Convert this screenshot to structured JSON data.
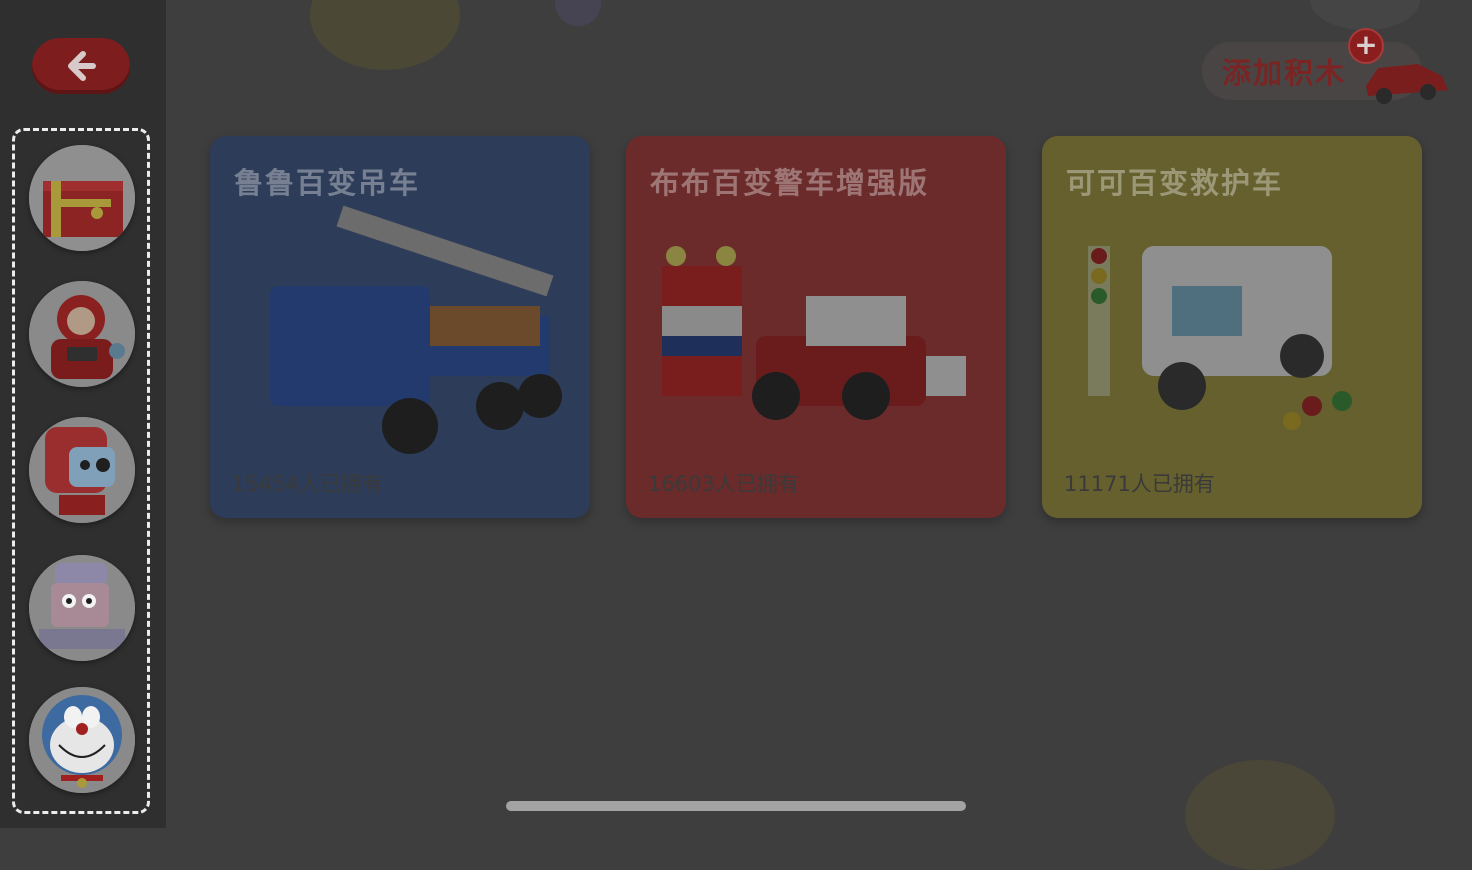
{
  "back_button": {
    "icon": "arrow-left-icon"
  },
  "avatars": [
    {
      "name": "toolbox-avatar"
    },
    {
      "name": "red-robot-avatar"
    },
    {
      "name": "pink-robot-avatar"
    },
    {
      "name": "lilac-robot-avatar"
    },
    {
      "name": "doraemon-avatar"
    }
  ],
  "add_block": {
    "label": "添加积木",
    "icon": "plus-icon"
  },
  "cards": [
    {
      "title": "鲁鲁百变吊车",
      "count": "15454人已拥有",
      "color": "#2a3a55",
      "accent": "#3b5a8c"
    },
    {
      "title": "布布百变警车增强版",
      "count": "16603人已拥有",
      "color": "#6a2a2a",
      "accent": "#9b3434"
    },
    {
      "title": "可可百变救护车",
      "count": "11171人已拥有",
      "color": "#6a6230",
      "accent": "#8f8538"
    }
  ],
  "colors": {
    "overlay": "#3e3e3e",
    "sidebar": "#2f2f2f",
    "brand_red": "#7e1d1d"
  }
}
